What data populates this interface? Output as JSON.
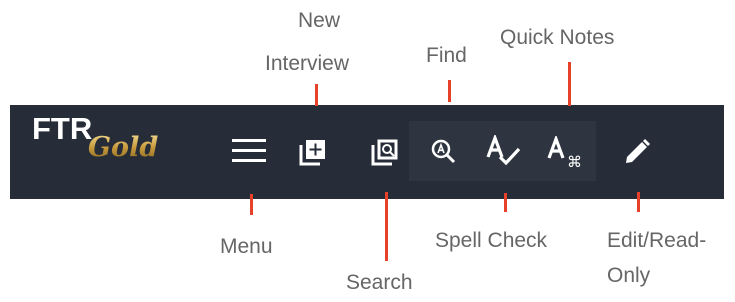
{
  "logo": {
    "primary": "FTR",
    "secondary": "Gold"
  },
  "toolbar": {
    "background": "#262d38",
    "icons": [
      {
        "name": "menu-icon",
        "symbol": "hamburger"
      },
      {
        "name": "new-interview-icon",
        "symbol": "stacked-plus"
      },
      {
        "name": "search-icon",
        "symbol": "stacked-magnifier"
      },
      {
        "name": "find-icon",
        "symbol": "magnifier-a"
      },
      {
        "name": "spell-check-icon",
        "symbol": "a-checkmark"
      },
      {
        "name": "quick-notes-icon",
        "symbol": "a-command"
      },
      {
        "name": "edit-read-only-icon",
        "symbol": "pencil"
      }
    ]
  },
  "labels": {
    "new_interview_line1": "New",
    "new_interview_line2": "Interview",
    "find": "Find",
    "quick_notes": "Quick Notes",
    "menu": "Menu",
    "spell_check": "Spell Check",
    "search": "Search",
    "edit_read_only_line1": "Edit/Read-",
    "edit_read_only_line2": "Only"
  },
  "colors": {
    "leader": "#e8412a",
    "label_text": "#666666",
    "icon": "#ffffff",
    "logo_gold": "#c9a24a"
  }
}
